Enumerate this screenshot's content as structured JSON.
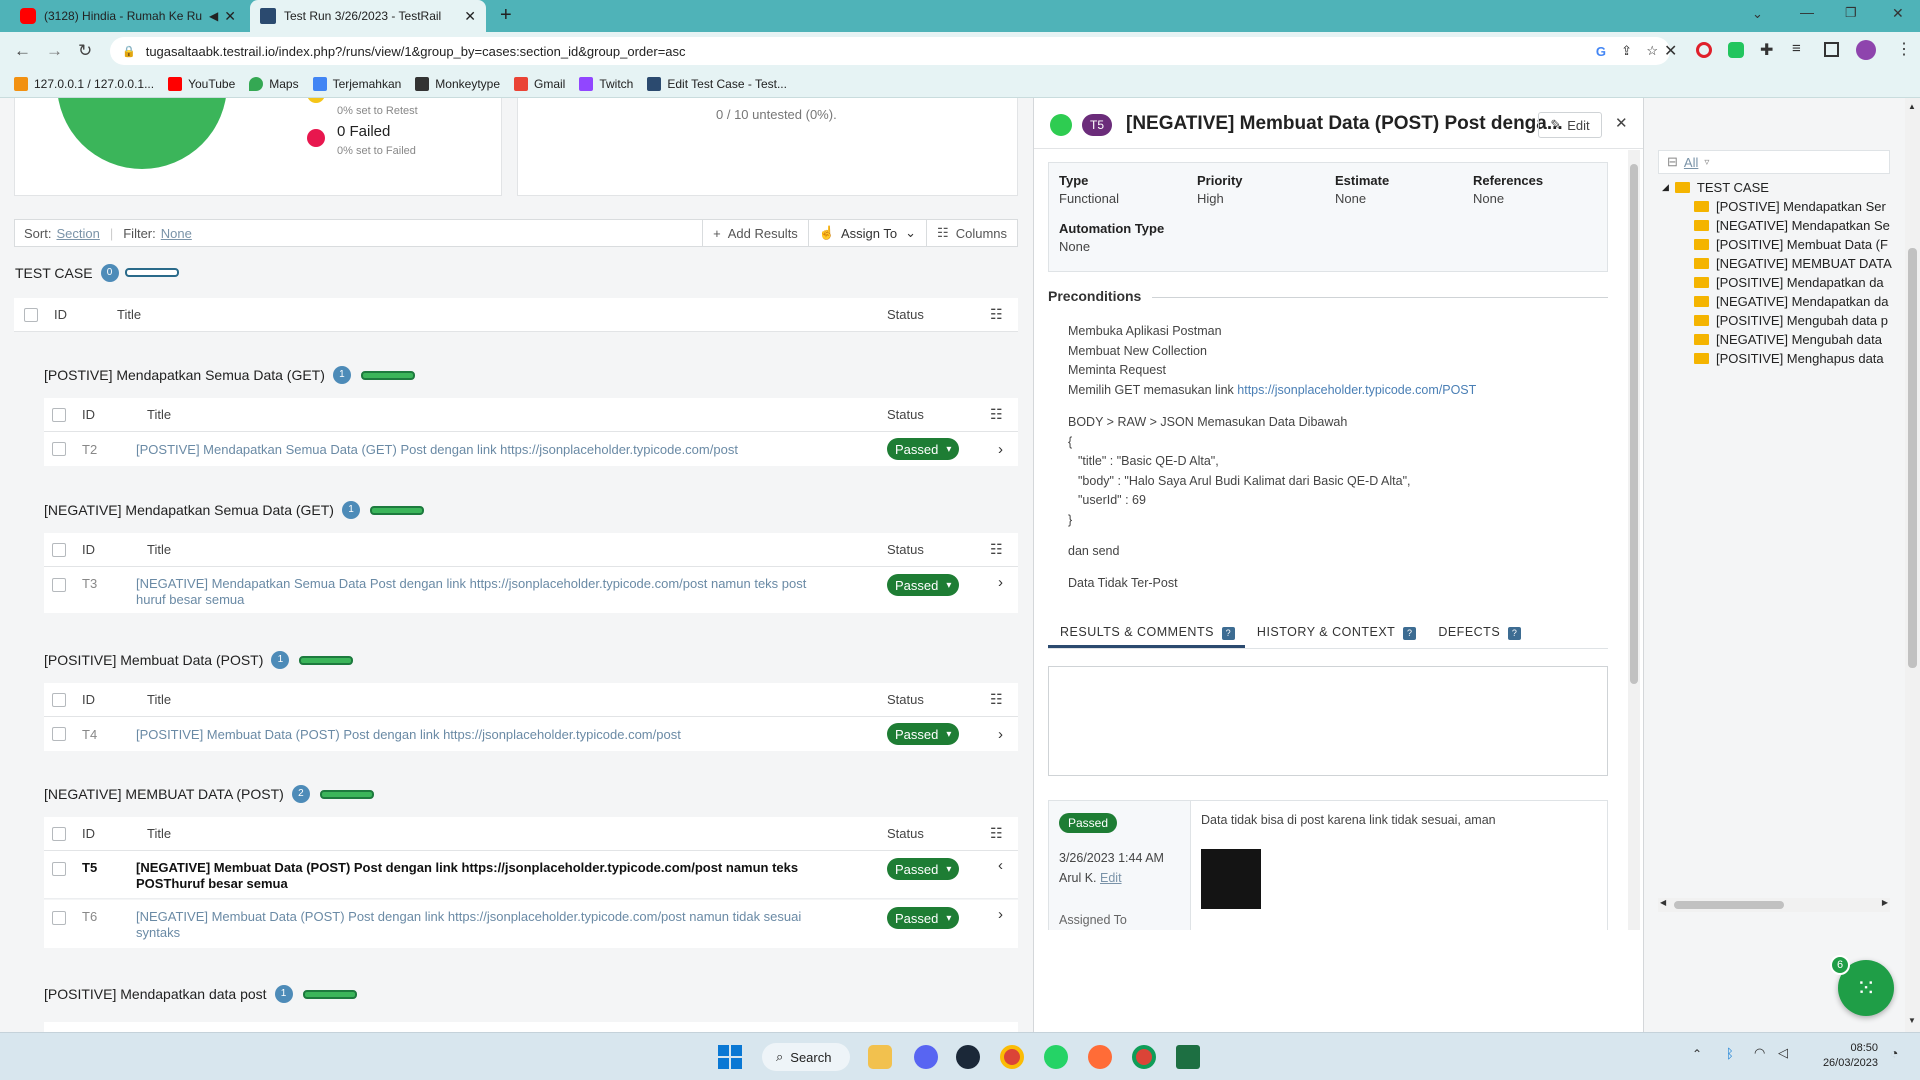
{
  "browser": {
    "tabs": [
      {
        "title": "(3128) Hindia - Rumah Ke Ru"
      },
      {
        "title": "Test Run 3/26/2023 - TestRail"
      }
    ],
    "url": "tugasaltaabk.testrail.io/index.php?/runs/view/1&group_by=cases:section_id&group_order=asc",
    "bookmarks": [
      "127.0.0.1 / 127.0.0.1...",
      "YouTube",
      "Maps",
      "Terjemahkan",
      "Monkeytype",
      "Gmail",
      "Twitch",
      "Edit Test Case - Test..."
    ]
  },
  "summary": {
    "failed_label": "0 Failed",
    "retest_note": "0% set to Retest",
    "failed_note": "0% set to Failed",
    "untested": "0 / 10 untested (0%)."
  },
  "filterbar": {
    "sort_label": "Sort:",
    "sort_value": "Section",
    "filter_label": "Filter:",
    "filter_value": "None",
    "add_results": "Add Results",
    "assign_to": "Assign To",
    "columns": "Columns"
  },
  "table": {
    "heading": "TEST CASE",
    "heading_count": "0",
    "col_id": "ID",
    "col_title": "Title",
    "col_status": "Status"
  },
  "sections": [
    {
      "name": "[POSTIVE] Mendapatkan Semua Data (GET)",
      "count": "1",
      "rows": [
        {
          "id": "T2",
          "title": "[POSTIVE] Mendapatkan Semua Data (GET) Post dengan link https://jsonplaceholder.typicode.com/post",
          "title2": "",
          "status": "Passed"
        }
      ]
    },
    {
      "name": "[NEGATIVE] Mendapatkan Semua Data (GET)",
      "count": "1",
      "rows": [
        {
          "id": "T3",
          "title": "[NEGATIVE] Mendapatkan Semua Data Post dengan link https://jsonplaceholder.typicode.com/post namun teks post",
          "title2": "huruf besar semua",
          "status": "Passed"
        }
      ]
    },
    {
      "name": "[POSITIVE] Membuat Data (POST)",
      "count": "1",
      "rows": [
        {
          "id": "T4",
          "title": "[POSITIVE] Membuat Data (POST) Post dengan link https://jsonplaceholder.typicode.com/post",
          "title2": "",
          "status": "Passed"
        }
      ]
    },
    {
      "name": "[NEGATIVE] MEMBUAT DATA (POST)",
      "count": "2",
      "rows": [
        {
          "id": "T5",
          "title": "[NEGATIVE] Membuat Data (POST) Post dengan link https://jsonplaceholder.typicode.com/post namun teks",
          "title2": "POSThuruf besar semua",
          "status": "Passed"
        },
        {
          "id": "T6",
          "title": "[NEGATIVE] Membuat Data (POST) Post dengan link https://jsonplaceholder.typicode.com/post namun tidak sesuai",
          "title2": "syntaks",
          "status": "Passed"
        }
      ]
    },
    {
      "name": "[POSITIVE] Mendapatkan data post",
      "count": "1",
      "rows": []
    }
  ],
  "detail": {
    "case_id": "T5",
    "title": "[NEGATIVE] Membuat Data (POST) Post denga...",
    "edit": "Edit",
    "fields": [
      {
        "label": "Type",
        "value": "Functional"
      },
      {
        "label": "Priority",
        "value": "High"
      },
      {
        "label": "Estimate",
        "value": "None"
      },
      {
        "label": "References",
        "value": "None"
      }
    ],
    "automation_label": "Automation Type",
    "automation_value": "None",
    "preconditions_heading": "Preconditions",
    "preconditions": [
      "Membuka Aplikasi Postman",
      "Membuat New Collection",
      "Meminta Request"
    ],
    "precondition_link_prefix": "Memilih GET memasukan link ",
    "precondition_link": "https://jsonplaceholder.typicode.com/POST",
    "body_lines": [
      "BODY > RAW > JSON Memasukan Data Dibawah",
      "{",
      "\"title\" : \"Basic QE-D Alta\",",
      "\"body\" : \"Halo Saya Arul Budi Kalimat dari Basic QE-D Alta\",",
      "\"userId\" : 69",
      "}"
    ],
    "send": "dan send",
    "result_text": "Data Tidak Ter-Post",
    "tabs": [
      "RESULTS & COMMENTS",
      "HISTORY & CONTEXT",
      "DEFECTS"
    ],
    "result": {
      "status": "Passed",
      "date": "3/26/2023 1:44 AM",
      "user": "Arul K.",
      "edit": "Edit",
      "assigned": "Assigned To",
      "comment": "Data tidak bisa di post karena link tidak sesuai, aman"
    }
  },
  "tree": {
    "filter": "All",
    "root": "TEST CASE",
    "items": [
      "[POSTIVE] Mendapatkan Ser",
      "[NEGATIVE] Mendapatkan Se",
      "[POSITIVE] Membuat Data (F",
      "[NEGATIVE] MEMBUAT DATA",
      "[POSITIVE] Mendapatkan da",
      "[NEGATIVE] Mendapatkan da",
      "[POSITIVE] Mengubah data p",
      "[NEGATIVE] Mengubah data",
      "[POSITIVE] Menghapus data"
    ]
  },
  "fab_count": "6",
  "taskbar": {
    "search": "Search",
    "time": "08:50",
    "date": "26/03/2023"
  },
  "colors": {
    "accent": "#4fb3b8",
    "passed": "#1e7d34",
    "badge": "#4d8bb8",
    "progress": "#3bb55a"
  }
}
